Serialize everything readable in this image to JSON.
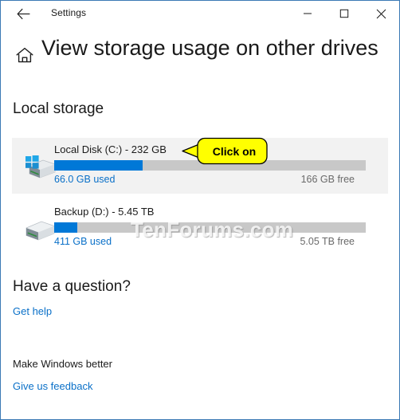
{
  "window": {
    "app_title": "Settings",
    "back_icon": "back-arrow-icon",
    "minimize_label": "–",
    "maximize_label": "□",
    "close_label": "✕"
  },
  "page": {
    "home_icon": "home-icon",
    "title": "View storage usage on other drives"
  },
  "local_storage": {
    "heading": "Local storage",
    "drives": [
      {
        "name": "Local Disk (C:) - 232 GB",
        "used_label": "66.0 GB used",
        "free_label": "166 GB free",
        "used_percent": 28.5,
        "icon": "hard-drive-windows-icon",
        "selected": true
      },
      {
        "name": "Backup (D:) - 5.45 TB",
        "used_label": "411 GB used",
        "free_label": "5.05 TB free",
        "used_percent": 7.4,
        "icon": "hard-drive-icon",
        "selected": false
      }
    ]
  },
  "help": {
    "heading": "Have a question?",
    "link": "Get help"
  },
  "feedback": {
    "label": "Make Windows better",
    "link": "Give us feedback"
  },
  "annotation": {
    "callout_text": "Click on"
  },
  "watermark": {
    "text": "TenForums.com"
  },
  "colors": {
    "accent_blue": "#0078d7",
    "link_blue": "#0a70c8",
    "track_gray": "#c8c8c8",
    "row_highlight": "#f2f2f2",
    "callout_yellow": "#ffff00",
    "window_border": "#3b79b5"
  }
}
